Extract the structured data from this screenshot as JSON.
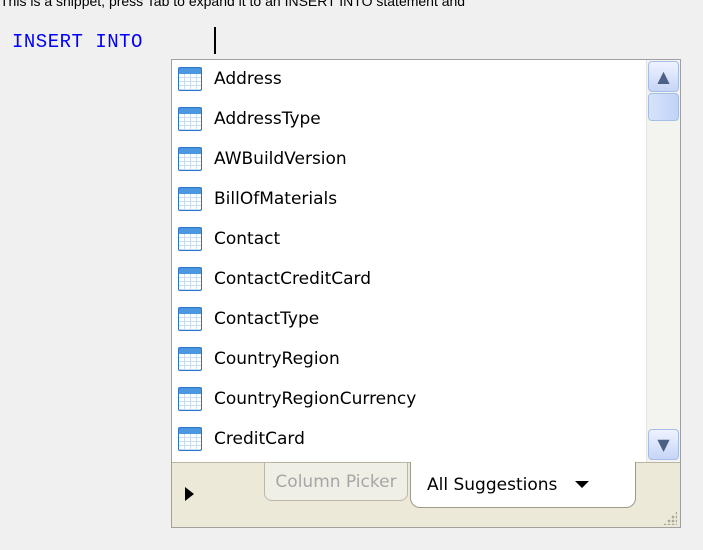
{
  "hint_text": "This is a snippet, press Tab to expand it to an INSERT INTO statement and",
  "editor": {
    "code": "INSERT INTO"
  },
  "completion": {
    "items": [
      {
        "label": "Address",
        "icon": "table-icon"
      },
      {
        "label": "AddressType",
        "icon": "table-icon"
      },
      {
        "label": "AWBuildVersion",
        "icon": "table-icon"
      },
      {
        "label": "BillOfMaterials",
        "icon": "table-icon"
      },
      {
        "label": "Contact",
        "icon": "table-icon"
      },
      {
        "label": "ContactCreditCard",
        "icon": "table-icon"
      },
      {
        "label": "ContactType",
        "icon": "table-icon"
      },
      {
        "label": "CountryRegion",
        "icon": "table-icon"
      },
      {
        "label": "CountryRegionCurrency",
        "icon": "table-icon"
      },
      {
        "label": "CreditCard",
        "icon": "table-icon"
      }
    ],
    "tabs": {
      "column_picker": "Column Picker",
      "all_suggestions": "All Suggestions"
    }
  },
  "colors": {
    "keyword": "#0000ff",
    "tab_bar": "#ece9d8",
    "scroll_button": "#c6d6f7"
  }
}
